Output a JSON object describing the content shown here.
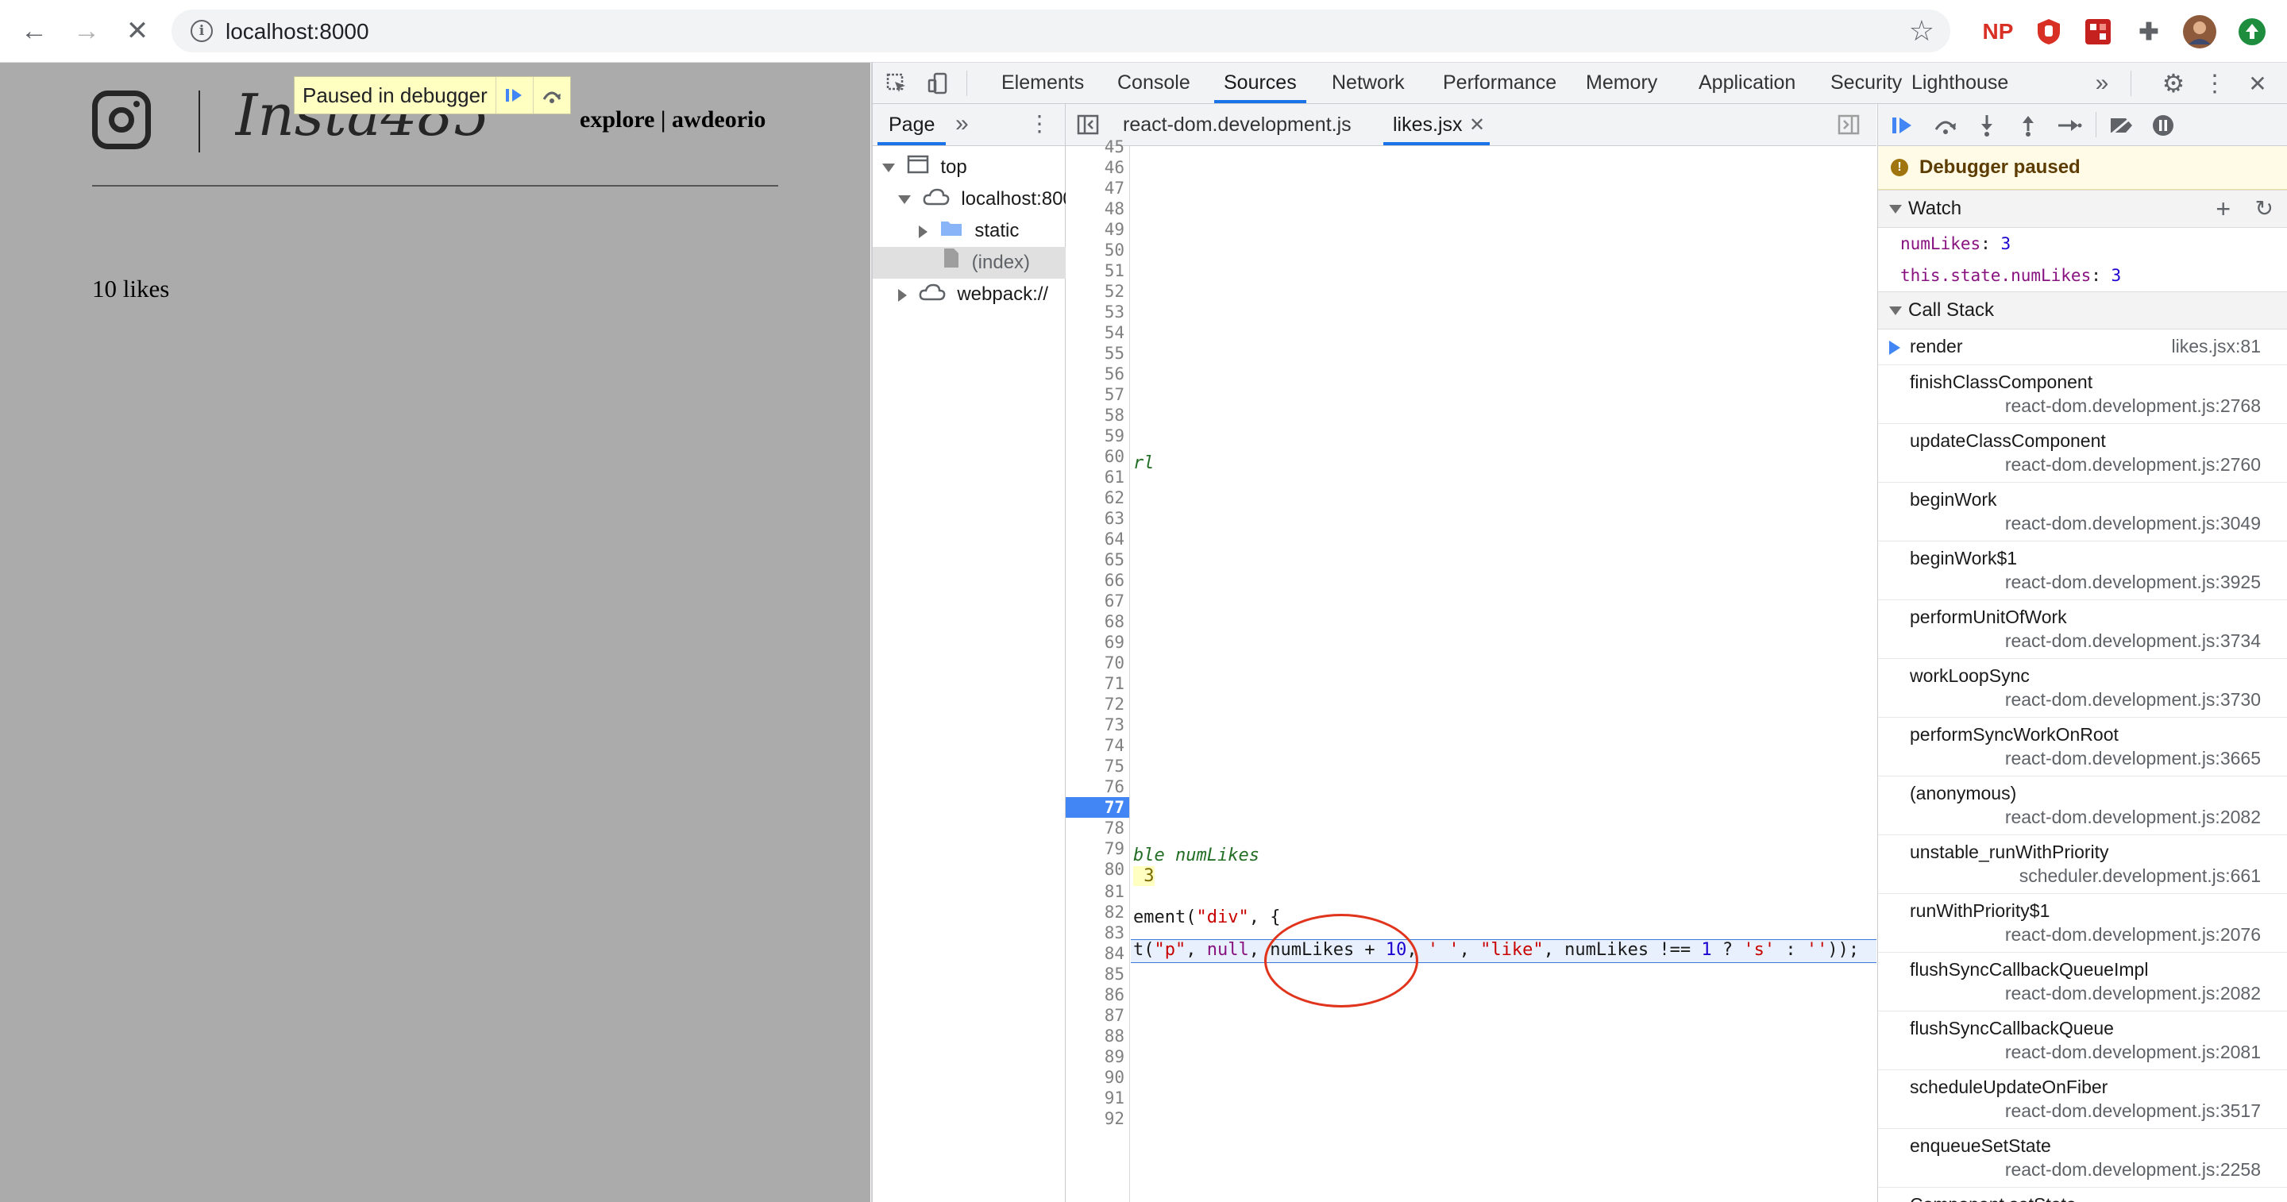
{
  "browser": {
    "url": "localhost:8000",
    "extensions": [
      "NP",
      "shield-extension",
      "puzzle-extension",
      "profile-avatar",
      "update-available"
    ]
  },
  "page": {
    "paused_overlay": "Paused in debugger",
    "brand": "Insta485",
    "nav_text": "explore | awdeorio",
    "likes_text": "10 likes"
  },
  "devtools": {
    "tabs": [
      "Elements",
      "Console",
      "Sources",
      "Network",
      "Performance",
      "Memory",
      "Application",
      "Security",
      "Lighthouse"
    ],
    "active_tab": "Sources",
    "navigator": {
      "tab": "Page",
      "tree": [
        "top",
        "localhost:8000",
        "static",
        "(index)",
        "webpack://"
      ]
    },
    "editor": {
      "tabs": [
        "react-dom.development.js",
        "likes.jsx"
      ],
      "active_tab": "likes.jsx",
      "first_line": 45,
      "last_line": 92,
      "breakpoint_line": 77,
      "paused_line": 81,
      "lines": {
        "57": "rl",
        "76": "ble numLikes",
        "77": " 3",
        "79_a": "ement(",
        "79_b": "\"div\"",
        "79_c": ", {",
        "81_a": "t(",
        "81_b": "\"p\"",
        "81_c": ", ",
        "81_d": "null",
        "81_e": ", numLikes + ",
        "81_f": "10",
        "81_g": ", ",
        "81_h": "' '",
        "81_i": ", ",
        "81_j": "\"like\"",
        "81_k": ", numLikes !== ",
        "81_l": "1",
        "81_m": " ? ",
        "81_n": "'s'",
        "81_o": " : ",
        "81_p": "''",
        "81_q": "));"
      }
    },
    "debugger": {
      "banner": "Debugger paused",
      "watch_title": "Watch",
      "watch": [
        {
          "key": "numLikes",
          "value": "3"
        },
        {
          "key": "this.state.numLikes",
          "value": "3"
        }
      ],
      "callstack_title": "Call Stack",
      "callstack": [
        {
          "name": "render",
          "loc": "likes.jsx:81"
        },
        {
          "name": "finishClassComponent",
          "loc": "react-dom.development.js:2768"
        },
        {
          "name": "updateClassComponent",
          "loc": "react-dom.development.js:2760"
        },
        {
          "name": "beginWork",
          "loc": "react-dom.development.js:3049"
        },
        {
          "name": "beginWork$1",
          "loc": "react-dom.development.js:3925"
        },
        {
          "name": "performUnitOfWork",
          "loc": "react-dom.development.js:3734"
        },
        {
          "name": "workLoopSync",
          "loc": "react-dom.development.js:3730"
        },
        {
          "name": "performSyncWorkOnRoot",
          "loc": "react-dom.development.js:3665"
        },
        {
          "name": "(anonymous)",
          "loc": "react-dom.development.js:2082"
        },
        {
          "name": "unstable_runWithPriority",
          "loc": "scheduler.development.js:661"
        },
        {
          "name": "runWithPriority$1",
          "loc": "react-dom.development.js:2076"
        },
        {
          "name": "flushSyncCallbackQueueImpl",
          "loc": "react-dom.development.js:2082"
        },
        {
          "name": "flushSyncCallbackQueue",
          "loc": "react-dom.development.js:2081"
        },
        {
          "name": "scheduleUpdateOnFiber",
          "loc": "react-dom.development.js:3517"
        },
        {
          "name": "enqueueSetState",
          "loc": "react-dom.development.js:2258"
        },
        {
          "name": "Component.setState",
          "loc": ""
        }
      ]
    }
  },
  "colors": {
    "accent": "#1a73e8",
    "breakpoint": "#4285f4",
    "paused_banner": "#fffbe6",
    "annotation_circle": "#e0341d",
    "page_overlay": "#ababab"
  }
}
